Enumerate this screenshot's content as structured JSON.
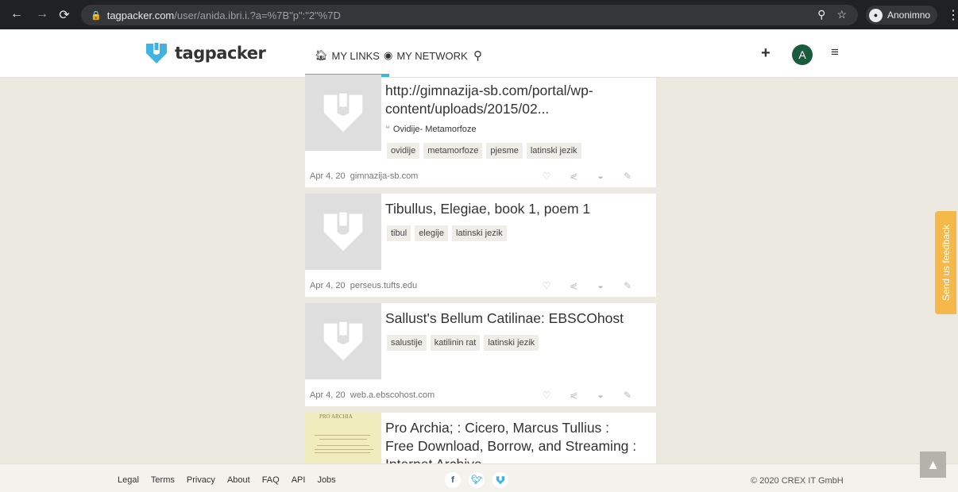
{
  "browser": {
    "url_host": "tagpacker.com",
    "url_path": "/user/anida.ibri.i.?a=%7B\"p\":\"2\"%7D",
    "profile_name": "Anonimno"
  },
  "header": {
    "logo_text": "tagpacker",
    "tabs": [
      {
        "label": "MY LINKS",
        "active": true
      },
      {
        "label": "MY NETWORK",
        "active": false
      }
    ],
    "avatar_letter": "A",
    "accent": "#40b3e3"
  },
  "cards": [
    {
      "title": "http://gimnazija-sb.com/portal/wp-content/uploads/2015/02...",
      "quote": "Ovidije- Metamorfoze",
      "tags": [
        "ovidije",
        "metamorfoze",
        "pjesme",
        "latinski jezik"
      ],
      "date": "Apr 4, 20",
      "domain": "gimnazija-sb.com"
    },
    {
      "title": "Tibullus, Elegiae, book 1, poem 1",
      "tags": [
        "tibul",
        "elegije",
        "latinski jezik"
      ],
      "date": "Apr 4, 20",
      "domain": "perseus.tufts.edu"
    },
    {
      "title": "Sallust's Bellum Catilinae: EBSCOhost",
      "tags": [
        "salustije",
        "katilinin rat",
        "latinski jezik"
      ],
      "date": "Apr 4, 20",
      "domain": "web.a.ebscohost.com"
    },
    {
      "title": "Pro Archia; : Cicero, Marcus Tullius : Free Download, Borrow, and Streaming : Internet Archive",
      "thumb_caption": "PRO ARCHIA"
    }
  ],
  "feedback_label": "Send us feedback",
  "footer": {
    "links": [
      "Legal",
      "Terms",
      "Privacy",
      "About",
      "FAQ",
      "API",
      "Jobs"
    ],
    "copyright": "© 2020 CREX IT GmbH"
  }
}
